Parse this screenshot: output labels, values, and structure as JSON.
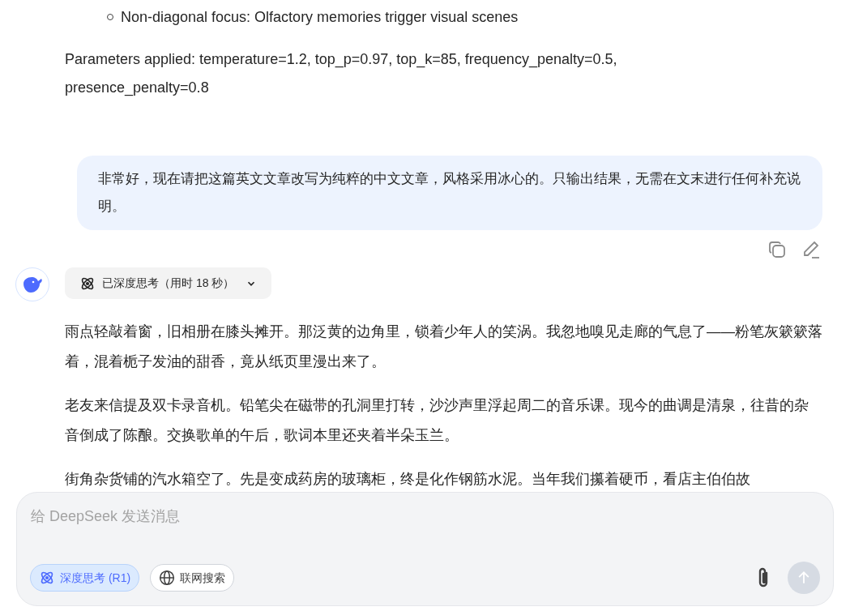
{
  "previous_answer": {
    "bullets": [
      "Non-diagonal focus: Olfactory memories trigger visual scenes"
    ],
    "parameters_text": "Parameters applied: temperature=1.2, top_p=0.97, top_k=85, frequency_penalty=0.5, presence_penalty=0.8"
  },
  "user_message": {
    "text": "非常好，现在请把这篇英文文章改写为纯粹的中文文章，风格采用冰心的。只输出结果，无需在文末进行任何补充说明。"
  },
  "assistant": {
    "thinking": {
      "label": "已深度思考（用时 18 秒）",
      "expanded": false
    },
    "paragraphs": [
      "雨点轻敲着窗，旧相册在膝头摊开。那泛黄的边角里，锁着少年人的笑涡。我忽地嗅见走廊的气息了——粉笔灰簌簌落着，混着栀子发油的甜香，竟从纸页里漫出来了。",
      "老友来信提及双卡录音机。铅笔尖在磁带的孔洞里打转，沙沙声里浮起周二的音乐课。现今的曲调是清泉，往昔的杂音倒成了陈酿。交换歌单的午后，歌词本里还夹着半朵玉兰。",
      "街角杂货铺的汽水箱空了。先是变成药房的玻璃柜，终是化作钢筋水泥。当年我们攥着硬币，看店主伯伯故"
    ]
  },
  "composer": {
    "placeholder": "给 DeepSeek 发送消息",
    "toggles": [
      {
        "kind": "think",
        "label": "深度思考 (R1)",
        "selected": true
      },
      {
        "kind": "search",
        "label": "联网搜索",
        "selected": false
      }
    ]
  }
}
